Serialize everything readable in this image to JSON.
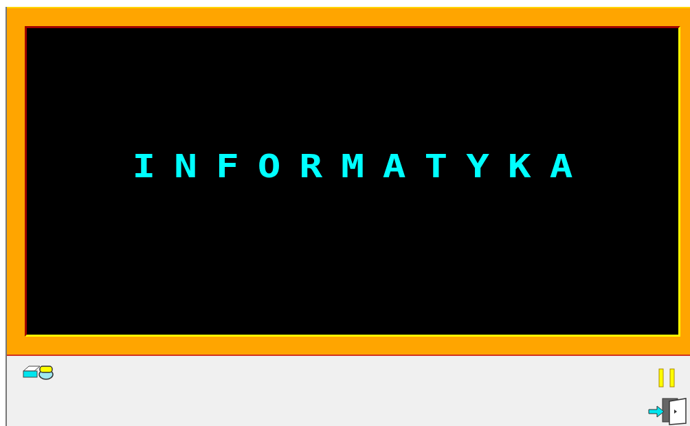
{
  "screen": {
    "title": "INFORMATYKA"
  }
}
